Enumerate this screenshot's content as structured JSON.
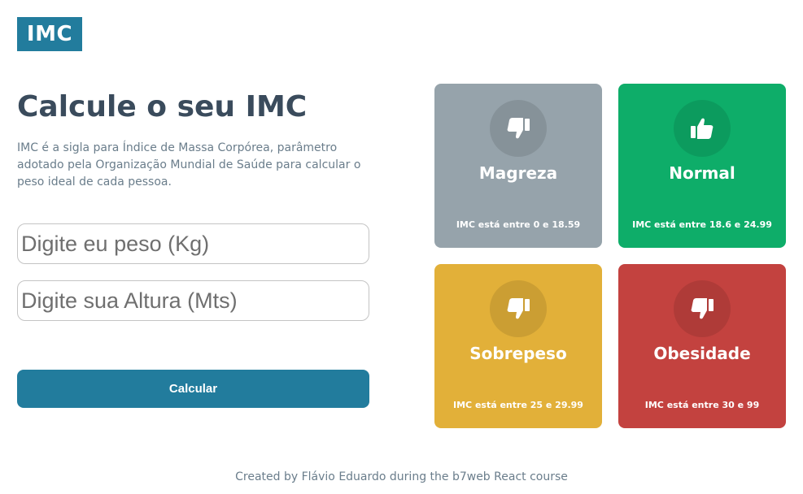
{
  "logo": {
    "text": "IMC",
    "color": "#227c9d"
  },
  "main": {
    "title": "Calcule o seu IMC",
    "description": "IMC é a sigla para Índice de Massa Corpórea, parâmetro adotado pela Organização Mundial de Saúde para calcular o peso ideal de cada pessoa.",
    "weight_input": {
      "placeholder": "Digite eu peso (Kg)",
      "value": ""
    },
    "height_input": {
      "placeholder": "Digite sua Altura (Mts)",
      "value": ""
    },
    "calculate_button": "Calcular"
  },
  "levels": [
    {
      "title": "Magreza",
      "range": "IMC está entre 0 e 18.59",
      "color": "#96a3ab",
      "icon": "thumbs-down-icon"
    },
    {
      "title": "Normal",
      "range": "IMC está entre 18.6 e 24.99",
      "color": "#0ead69",
      "icon": "thumbs-up-icon"
    },
    {
      "title": "Sobrepeso",
      "range": "IMC está entre 25 e 29.99",
      "color": "#e2b039",
      "icon": "thumbs-down-icon"
    },
    {
      "title": "Obesidade",
      "range": "IMC está entre 30 e 99",
      "color": "#c3423f",
      "icon": "thumbs-down-icon"
    }
  ],
  "footer": "Created by Flávio Eduardo during the b7web React course"
}
